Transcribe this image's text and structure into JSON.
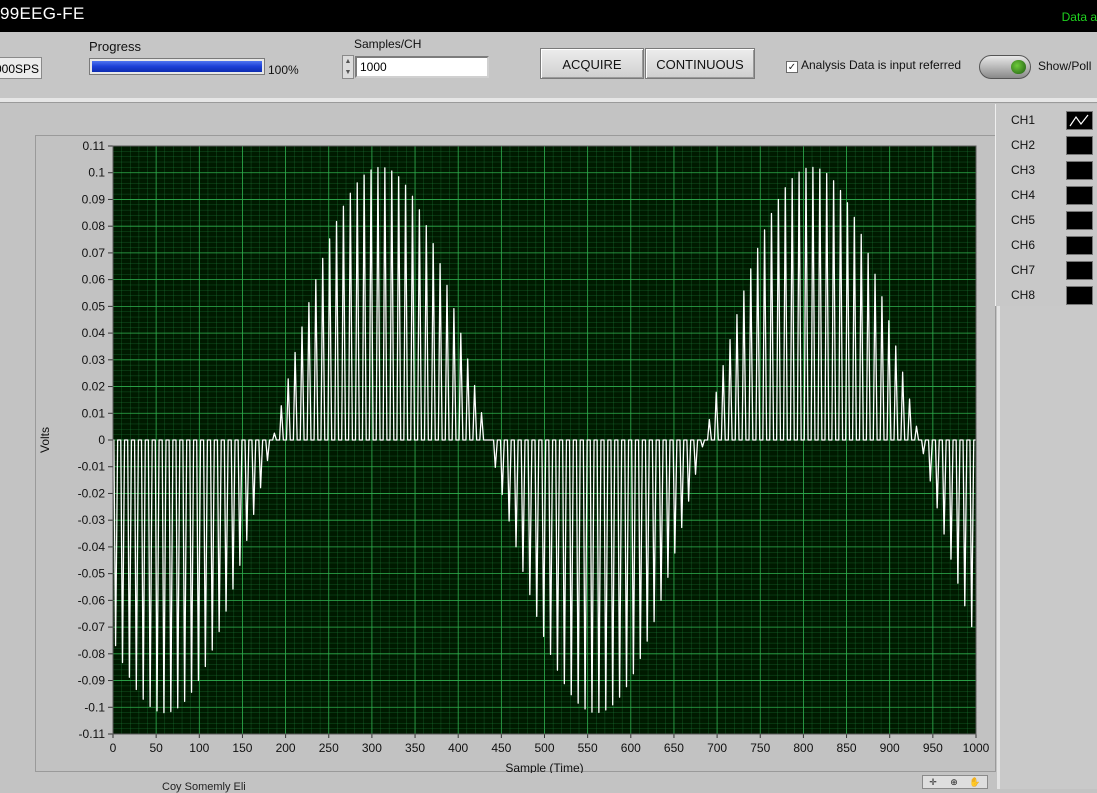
{
  "window": {
    "title": "99EEG-FE",
    "status_text": "Data a"
  },
  "toolbar": {
    "sps_value": "000SPS",
    "progress": {
      "label": "Progress",
      "value": 100,
      "value_text": "100%"
    },
    "samples": {
      "label": "Samples/CH",
      "value": "1000"
    },
    "acquire_label": "ACQUIRE",
    "continuous_label": "CONTINUOUS",
    "analysis_checkbox": {
      "label": "Analysis Data is input referred",
      "checked": true
    },
    "showpoll_label": "Show/Poll"
  },
  "legend": {
    "channels": [
      {
        "name": "CH1",
        "active": true
      },
      {
        "name": "CH2",
        "active": false
      },
      {
        "name": "CH3",
        "active": false
      },
      {
        "name": "CH4",
        "active": false
      },
      {
        "name": "CH5",
        "active": false
      },
      {
        "name": "CH6",
        "active": false
      },
      {
        "name": "CH7",
        "active": false
      },
      {
        "name": "CH8",
        "active": false
      }
    ]
  },
  "bottom_label": "Coy Somemly Eli",
  "chart_data": {
    "type": "line",
    "xlabel": "Sample (Time)",
    "ylabel": "Volts",
    "xlim": [
      0,
      1000
    ],
    "ylim": [
      -0.11,
      0.11
    ],
    "x_ticks": [
      0,
      50,
      100,
      150,
      200,
      250,
      300,
      350,
      400,
      450,
      500,
      550,
      600,
      650,
      700,
      750,
      800,
      850,
      900,
      950,
      1000
    ],
    "y_ticks": [
      0.11,
      0.1,
      0.09,
      0.08,
      0.07,
      0.06,
      0.05,
      0.04,
      0.03,
      0.02,
      0.01,
      0,
      -0.01,
      -0.02,
      -0.03,
      -0.04,
      -0.05,
      -0.06,
      -0.07,
      -0.08,
      -0.09,
      -0.1,
      -0.11
    ],
    "grid": true,
    "plot_background": "#001a00",
    "grid_color": "#1f7a3a",
    "series_color": "#ffffff",
    "series": [
      {
        "name": "CH1",
        "signal": "sampled sine with baseline returns",
        "amplitude": 0.102,
        "period_samples": 500,
        "zero_crossing_sample": 187,
        "pulse_spacing_samples": 8,
        "envelope_x": [
          0,
          60,
          187,
          315,
          440,
          565,
          690,
          815,
          940,
          1000
        ],
        "envelope_y": [
          -0.08,
          -0.106,
          0.0,
          0.102,
          0.0,
          -0.106,
          0.0,
          0.102,
          0.0,
          -0.07
        ]
      }
    ]
  }
}
